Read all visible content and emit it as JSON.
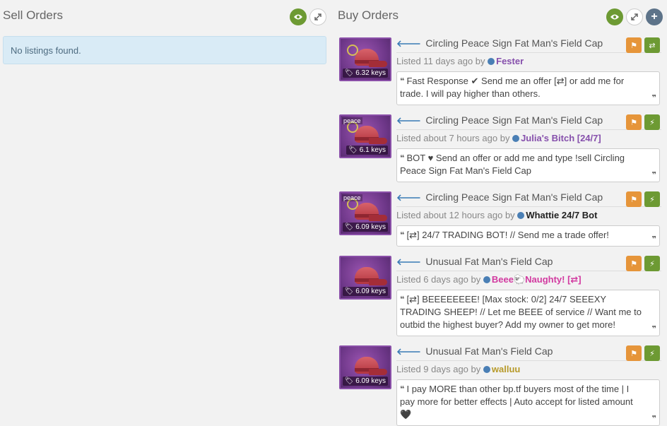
{
  "sell": {
    "title": "Sell Orders",
    "empty_text": "No listings found."
  },
  "buy": {
    "title": "Buy Orders",
    "listings": [
      {
        "item": "Circling Peace Sign Fat Man's Field Cap",
        "tag": "",
        "price": "6.32 keys",
        "listed": "Listed 11 days ago by",
        "user": "Fester",
        "message": "Fast Response ✔ Send me an offer [⇄] or add me for trade. I will pay higher than others.",
        "action": "⇄"
      },
      {
        "item": "Circling Peace Sign Fat Man's Field Cap",
        "tag": "peace",
        "price": "6.1 keys",
        "listed": "Listed about 7 hours ago by",
        "user": "Julia's Bitch [24/7]",
        "message": "BOT ♥ Send an offer or add me and type !sell Circling Peace Sign Fat Man's Field Cap",
        "action": "⚡"
      },
      {
        "item": "Circling Peace Sign Fat Man's Field Cap",
        "tag": "peace",
        "price": "6.09 keys",
        "listed": "Listed about 12 hours ago by",
        "user": "Whattie 24/7 Bot",
        "message": "[⇄] 24/7 TRADING BOT! // Send me a trade offer!",
        "action": "⚡"
      },
      {
        "item": "Unusual Fat Man's Field Cap",
        "tag": "",
        "price": "6.09 keys",
        "listed": "Listed 6 days ago by",
        "user": "Beee🐑Naughty! [⇄]",
        "message": "[⇄] BEEEEEEEE! [Max stock: 0/2] 24/7 SEEEXY TRADING SHEEP! // Let me BEEE of service // Want me to outbid the highest buyer? Add my owner to get more!",
        "action": "⚡"
      },
      {
        "item": "Unusual Fat Man's Field Cap",
        "tag": "",
        "price": "6.09 keys",
        "listed": "Listed 9 days ago by",
        "user": "walluu",
        "message": "I pay MORE than other bp.tf buyers most of the time | I pay more for better effects | Auto accept for listed amount 🖤",
        "action": "⚡"
      }
    ]
  },
  "icons": {
    "visibility": "eye-icon",
    "expand": "expand-icon",
    "add": "plus-icon",
    "report": "flag-icon",
    "trade": "exchange-icon",
    "instant": "lightning-icon"
  },
  "colors": {
    "accent_green": "#6d9a33",
    "accent_orange": "#e6953a",
    "info_bg": "#d9ebf6",
    "effect_purple": "#6c3687"
  }
}
